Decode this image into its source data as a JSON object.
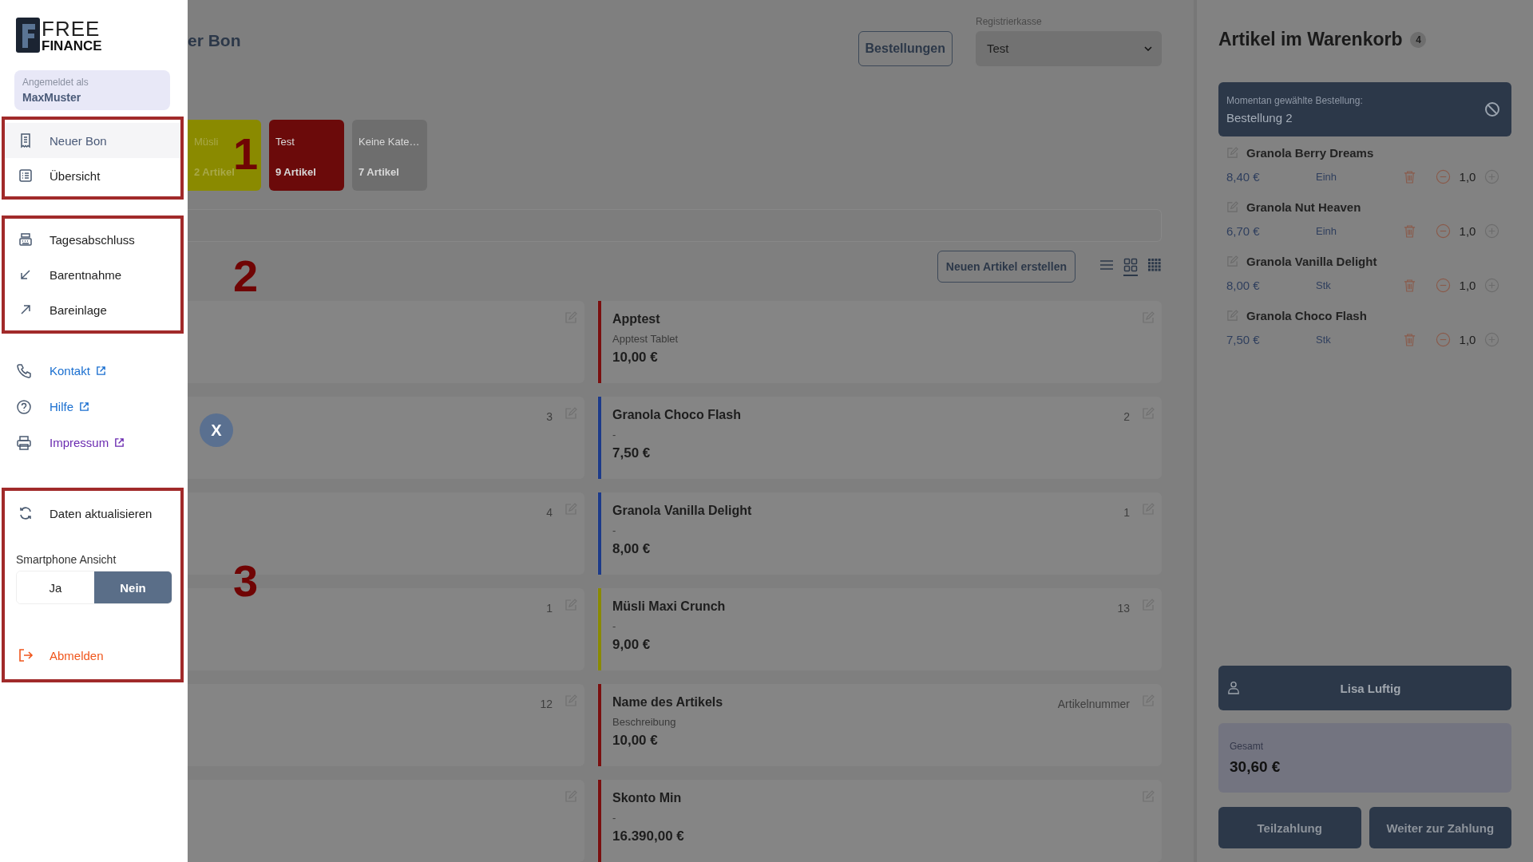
{
  "sidebar": {
    "logo": {
      "line_1": "FREE",
      "line_2": "FINANCE"
    },
    "user": {
      "label": "Angemeldet als",
      "name": "MaxMuster"
    },
    "nav_groups": [
      [
        {
          "label": "Neuer Bon",
          "selected": true
        },
        {
          "label": "Übersicht",
          "selected": false
        }
      ],
      [
        {
          "label": "Tagesabschluss",
          "selected": false
        },
        {
          "label": "Barentnahme",
          "selected": false
        },
        {
          "label": "Bareinlage",
          "selected": false
        }
      ]
    ],
    "links": [
      {
        "label": "Kontakt",
        "visited": false
      },
      {
        "label": "Hilfe",
        "visited": false
      },
      {
        "label": "Impressum",
        "visited": true
      }
    ],
    "refresh": "Daten aktualisieren",
    "smartphone_view": {
      "label": "Smartphone Ansicht",
      "options": [
        {
          "label": "Ja",
          "selected": false
        },
        {
          "label": "Nein",
          "selected": true
        }
      ]
    },
    "logout": "Abmelden"
  },
  "annotations": [
    {
      "number": "1"
    },
    {
      "number": "2"
    },
    {
      "number": "3"
    }
  ],
  "header": {
    "title": "er Bon",
    "orders_button": "Bestellungen",
    "register": {
      "label": "Registrierkasse",
      "value": "Test"
    }
  },
  "categories": [
    {
      "name": "Müsli",
      "count": "2 Artikel",
      "color": "#8a8a00"
    },
    {
      "name": "Test",
      "count": "9 Artikel",
      "color": "#6b0a0a"
    },
    {
      "name": "Keine Kate…",
      "count": "7 Artikel",
      "color": "#6e6e6e"
    }
  ],
  "toolbar": {
    "new_button": "Neuen Artikel erstellen",
    "views": [
      {
        "selected": false
      },
      {
        "selected": true
      },
      {
        "selected": false
      }
    ]
  },
  "articles_left": [
    {
      "kind": "plain"
    },
    {
      "kind": "numbered",
      "number": "3"
    },
    {
      "kind": "numbered",
      "number": "4"
    },
    {
      "kind": "numbered",
      "number": "1"
    },
    {
      "kind": "numbered",
      "number": "12"
    },
    {
      "kind": "plain"
    }
  ],
  "articles": [
    {
      "name": "Apptest",
      "description": "Apptest Tablet",
      "price": "10,00 €",
      "color": "#7a0f0f"
    },
    {
      "name": "Granola Choco Flash",
      "description": "-",
      "price": "7,50 €",
      "number": "2",
      "color": "#1c3a8a"
    },
    {
      "name": "Granola Vanilla Delight",
      "description": "-",
      "price": "8,00 €",
      "number": "1",
      "color": "#1c3a8a"
    },
    {
      "name": "Müsli Maxi Crunch",
      "description": "-",
      "price": "9,00 €",
      "number": "13",
      "color": "#8a8a00"
    },
    {
      "name": "Name des Artikels",
      "description": "Beschreibung",
      "price": "10,00 €",
      "number": "Artikelnummer",
      "color": "#7a0f0f"
    },
    {
      "name": "Skonto Min",
      "description": "-",
      "price": "16.390,00 €",
      "color": "#7a0f0f"
    }
  ],
  "close_button": "X",
  "cart": {
    "title": "Artikel im Warenkorb",
    "count": "4",
    "current_order": {
      "label": "Momentan gewählte Bestellung:",
      "name": "Bestellung 2"
    },
    "items": [
      {
        "name": "Granola Berry Dreams",
        "price": "8,40 €",
        "unit": "Einh",
        "quantity": "1,0"
      },
      {
        "name": "Granola Nut Heaven",
        "price": "6,70 €",
        "unit": "Einh",
        "quantity": "1,0"
      },
      {
        "name": "Granola Vanilla Delight",
        "price": "8,00 €",
        "unit": "Stk",
        "quantity": "1,0"
      },
      {
        "name": "Granola Choco Flash",
        "price": "7,50 €",
        "unit": "Stk",
        "quantity": "1,0"
      }
    ],
    "customer": "Lisa Luftig",
    "total": {
      "label": "Gesamt",
      "value": "30,60 €"
    },
    "buttons": [
      "Teilzahlung",
      "Weiter zur Zahlung"
    ]
  }
}
